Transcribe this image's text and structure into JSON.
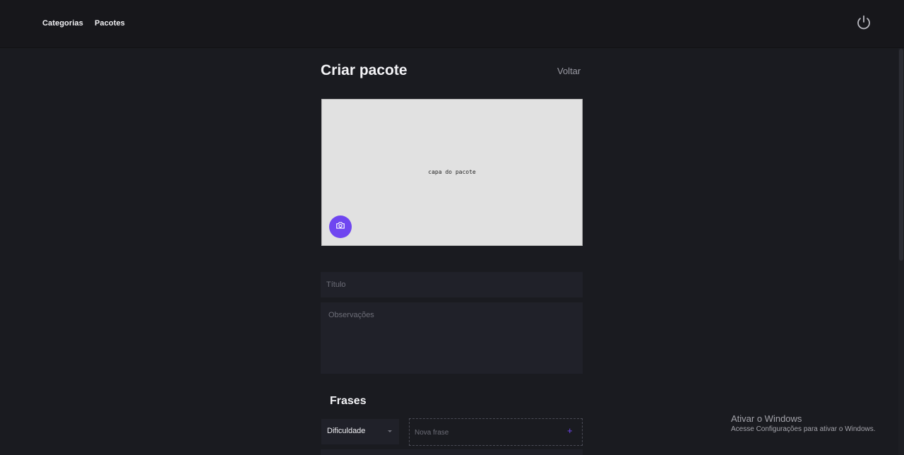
{
  "nav": {
    "items": [
      {
        "label": "Categorias"
      },
      {
        "label": "Pacotes"
      }
    ],
    "power_icon": "power-icon"
  },
  "page": {
    "title": "Criar pacote",
    "back_label": "Voltar"
  },
  "cover": {
    "placeholder_text": "capa do pacote",
    "camera_icon": "camera-icon"
  },
  "form": {
    "titulo_placeholder": "Título",
    "observacoes_placeholder": "Observações"
  },
  "frases": {
    "section_title": "Frases",
    "difficulty_label": "Dificuldade",
    "new_phrase_placeholder": "Nova frase",
    "add_symbol": "+"
  },
  "watermark": {
    "title": "Ativar o Windows",
    "subtitle": "Acesse Configurações para ativar o Windows."
  },
  "colors": {
    "accent": "#6f46f0",
    "background": "#1a1b20",
    "topbar": "#17171b",
    "field": "#202129"
  }
}
